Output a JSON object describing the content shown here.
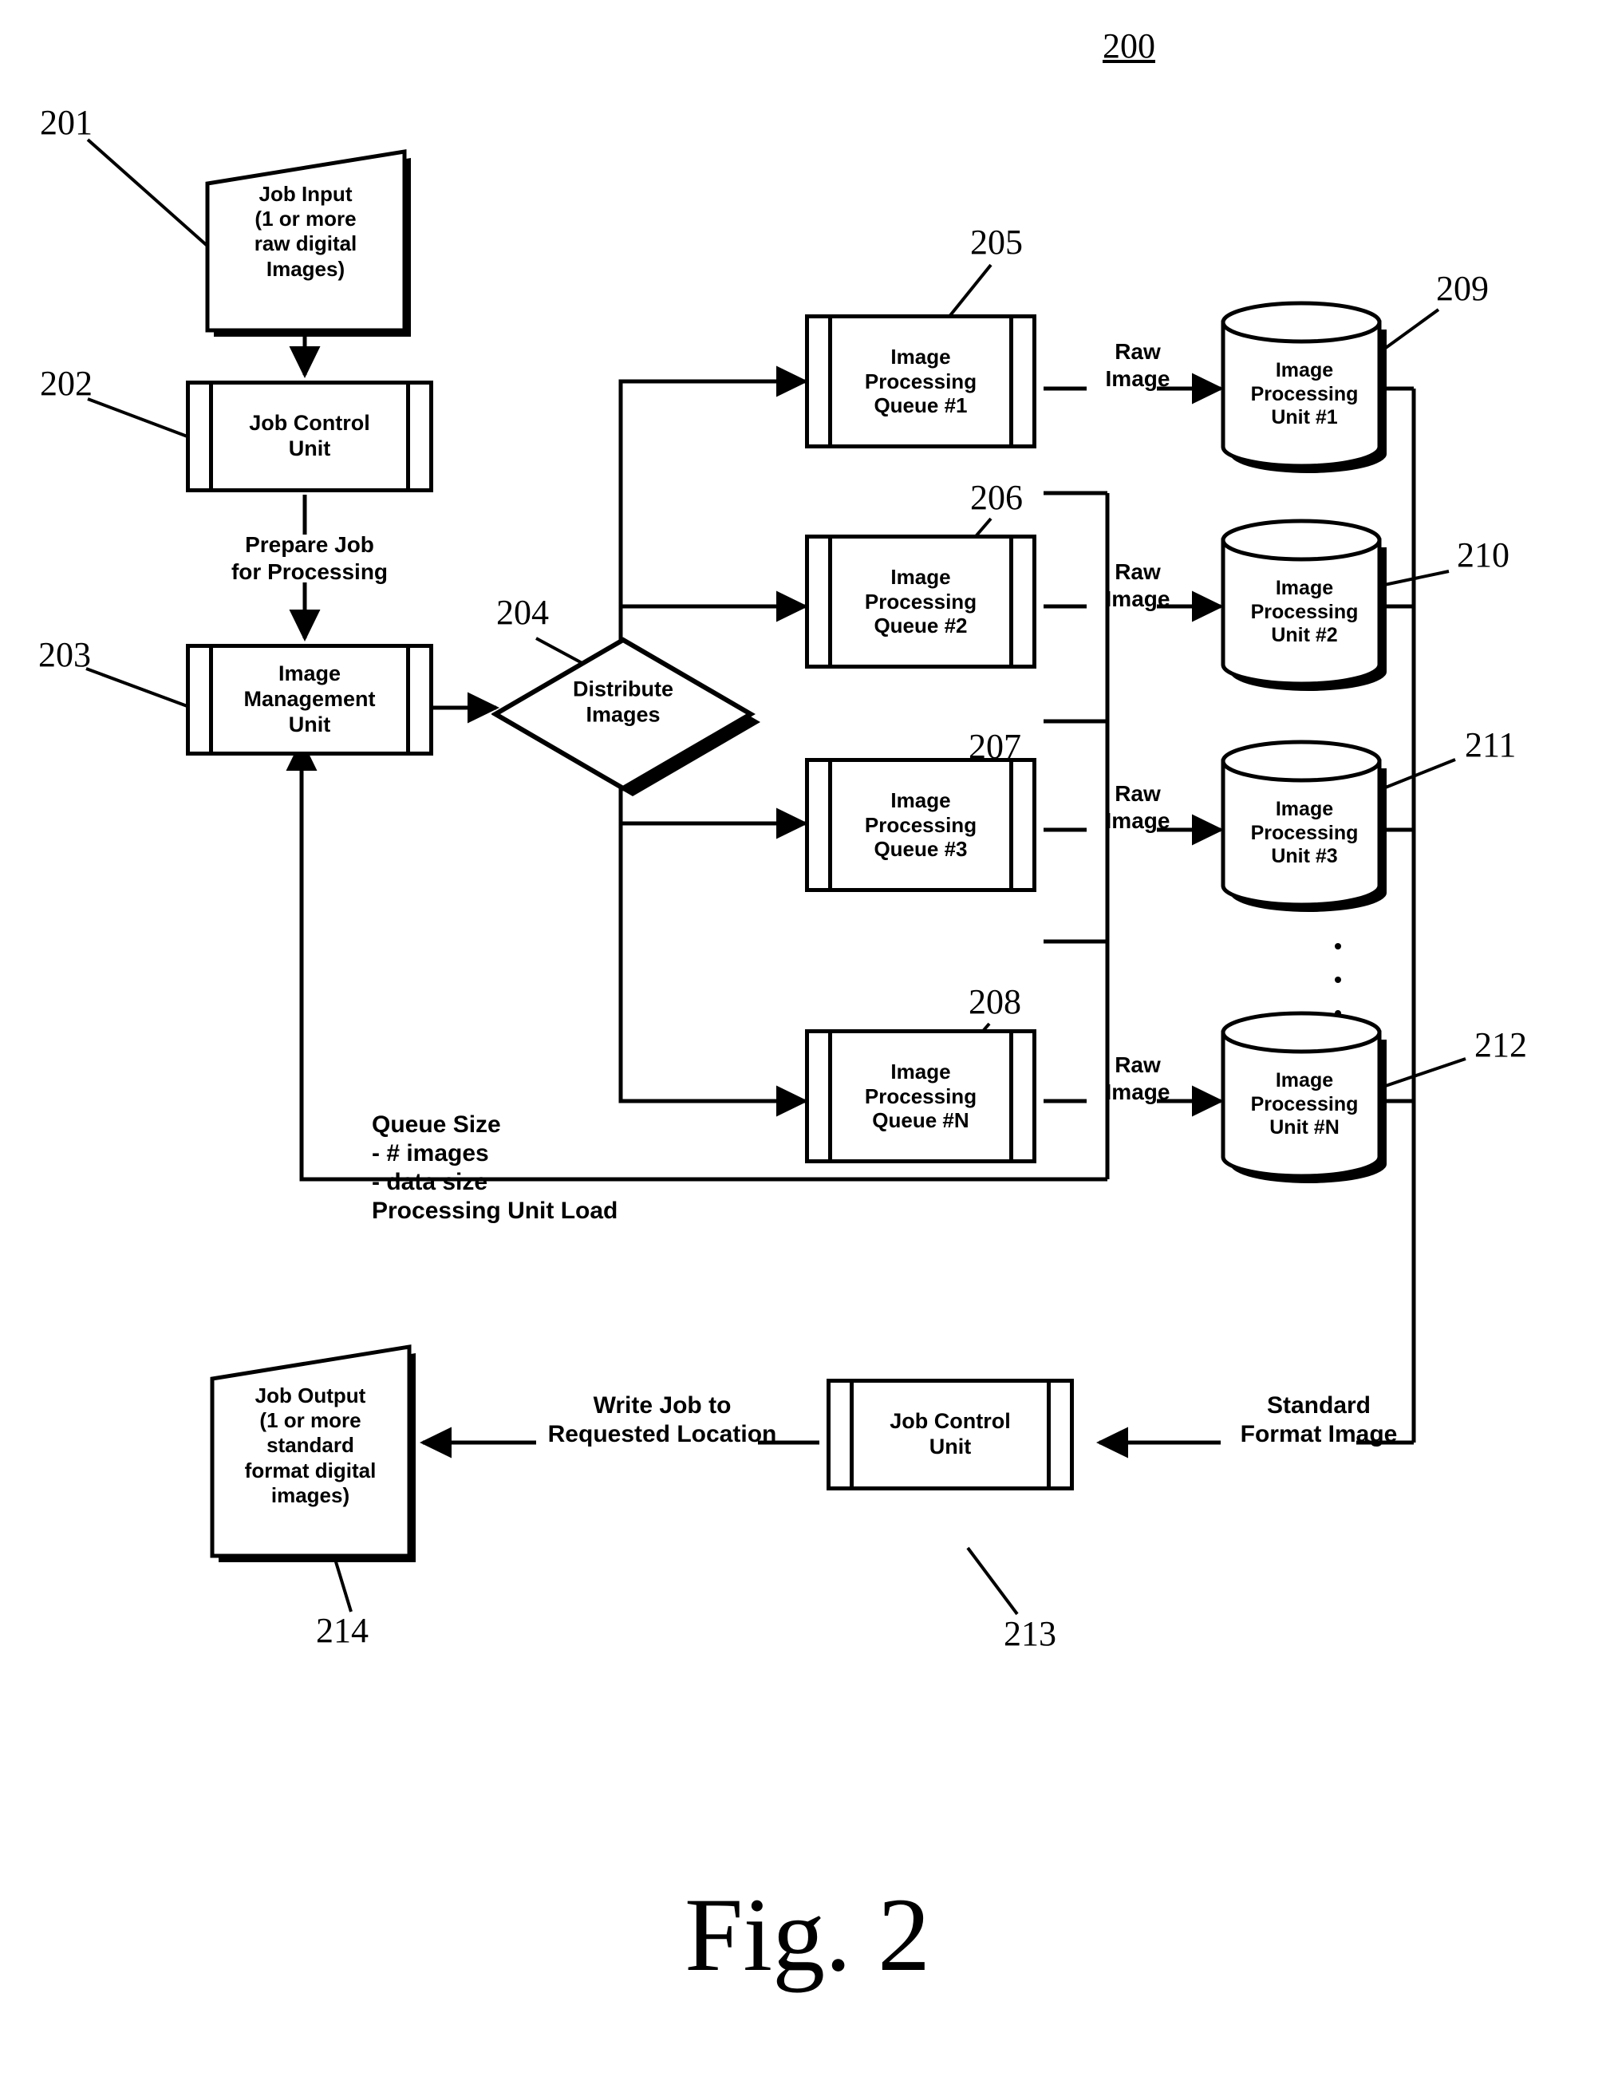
{
  "figure": {
    "number_label": "200",
    "caption": "Fig. 2"
  },
  "nodes": {
    "job_input": {
      "ref": "201",
      "lines": [
        "Job Input",
        "(1 or more",
        "raw digital",
        "Images)"
      ]
    },
    "job_control_unit_top": {
      "ref": "202",
      "lines": [
        "Job Control",
        "Unit"
      ]
    },
    "image_management_unit": {
      "ref": "203",
      "lines": [
        "Image",
        "Management",
        "Unit"
      ]
    },
    "distribute_images": {
      "ref": "204",
      "lines": [
        "Distribute",
        "Images"
      ]
    },
    "queues": [
      {
        "ref": "205",
        "lines": [
          "Image",
          "Processing",
          "Queue #1"
        ]
      },
      {
        "ref": "206",
        "lines": [
          "Image",
          "Processing",
          "Queue #2"
        ]
      },
      {
        "ref": "207",
        "lines": [
          "Image",
          "Processing",
          "Queue #3"
        ]
      },
      {
        "ref": "208",
        "lines": [
          "Image",
          "Processing",
          "Queue #N"
        ]
      }
    ],
    "units": [
      {
        "ref": "209",
        "lines": [
          "Image",
          "Processing",
          "Unit #1"
        ]
      },
      {
        "ref": "210",
        "lines": [
          "Image",
          "Processing",
          "Unit #2"
        ]
      },
      {
        "ref": "211",
        "lines": [
          "Image",
          "Processing",
          "Unit #3"
        ]
      },
      {
        "ref": "212",
        "lines": [
          "Image",
          "Processing",
          "Unit #N"
        ]
      }
    ],
    "job_control_unit_bottom": {
      "ref": "213",
      "lines": [
        "Job Control",
        "Unit"
      ]
    },
    "job_output": {
      "ref": "214",
      "lines": [
        "Job Output",
        "(1 or more",
        "standard",
        "format digital",
        "images)"
      ]
    }
  },
  "edge_labels": {
    "prepare_job": "Prepare Job\nfor Processing",
    "raw_image_1": "Raw\nImage",
    "raw_image_2": "Raw\nImage",
    "raw_image_3": "Raw\nImage",
    "raw_image_n": "Raw\nImage",
    "queue_feedback": "Queue Size\n   - # images\n   - data size\nProcessing Unit Load",
    "write_job": "Write Job to\nRequested Location",
    "standard_format_image": "Standard\nFormat Image"
  },
  "colors": {
    "stroke": "#000000",
    "fill": "#ffffff"
  }
}
